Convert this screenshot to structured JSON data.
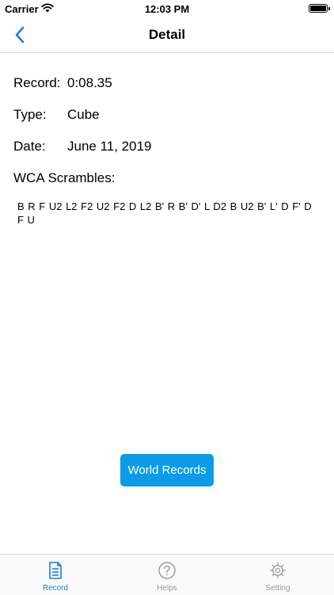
{
  "status_bar": {
    "carrier": "Carrier",
    "time": "12:03 PM"
  },
  "nav": {
    "title": "Detail",
    "back_icon": "chevron-left-icon"
  },
  "detail": {
    "record_label": "Record:",
    "record_value": "0:08.35",
    "type_label": "Type:",
    "type_value": "Cube",
    "date_label": "Date:",
    "date_value": "June 11, 2019",
    "scrambles_label": "WCA Scrambles:",
    "scrambles_value": "B R F U2 L2 F2 U2 F2 D L2 B' R B' D' L D2 B U2 B' L' D F' D F U"
  },
  "world_records_button": "World Records",
  "colors": {
    "accent": "#1e7fd6",
    "button": "#0a9ce8",
    "inactive": "#9a9a9f"
  },
  "tab_bar": {
    "items": [
      {
        "label": "Record",
        "icon": "document-icon",
        "active": true
      },
      {
        "label": "Helps",
        "icon": "question-circle-icon",
        "active": false
      },
      {
        "label": "Setting",
        "icon": "gear-icon",
        "active": false
      }
    ]
  }
}
